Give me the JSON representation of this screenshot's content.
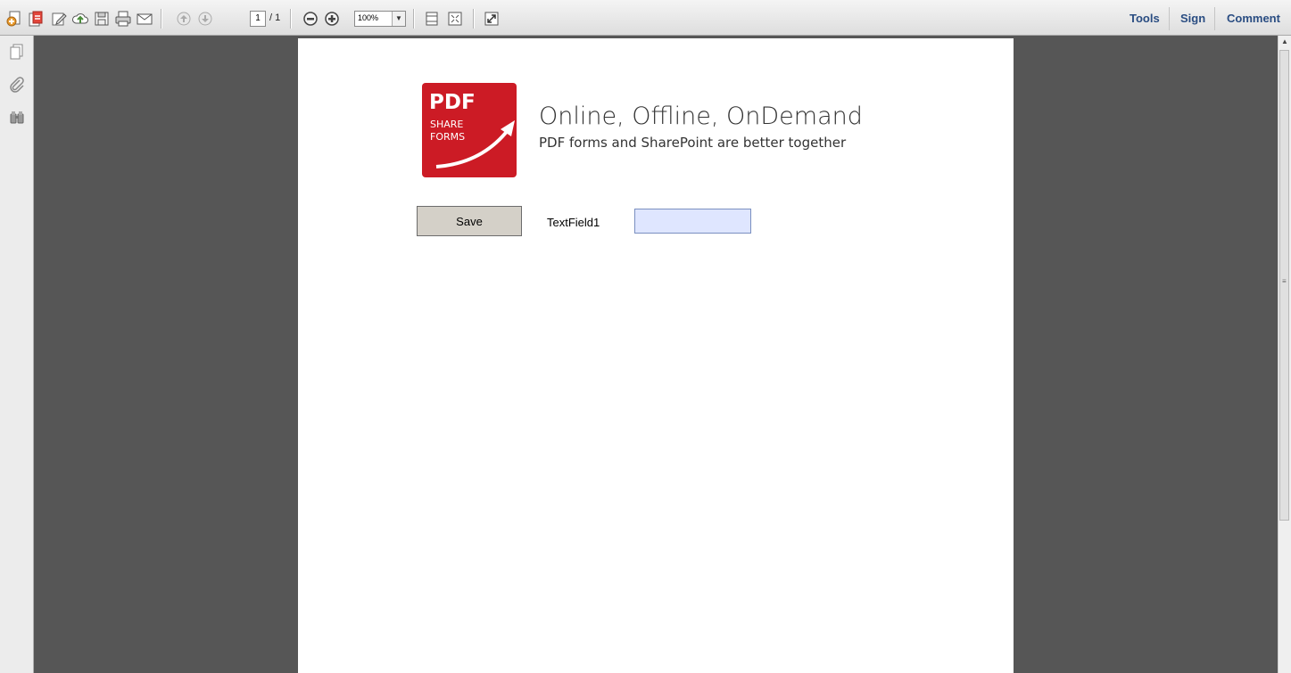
{
  "toolbar": {
    "page_current": "1",
    "page_total": "/ 1",
    "zoom": "100%",
    "tools_label": "Tools",
    "sign_label": "Sign",
    "comment_label": "Comment"
  },
  "icons": [
    "create-pdf-icon",
    "open-pdf-icon",
    "edit-icon",
    "upload-cloud-icon",
    "save-icon",
    "print-icon",
    "email-icon",
    "previous-page-icon",
    "next-page-icon",
    "zoom-out-icon",
    "zoom-in-icon",
    "fit-width-icon",
    "fit-page-icon",
    "full-screen-icon",
    "pages-panel-icon",
    "attachments-icon",
    "search-binoculars-icon"
  ],
  "document": {
    "logo": {
      "line1": "PDF",
      "line2": "SHARE",
      "line3": "FORMS"
    },
    "headline": "Online, Offline, OnDemand",
    "subline": "PDF forms and SharePoint are better together",
    "save_button": "Save",
    "field_label": "TextField1",
    "field_value": ""
  },
  "colors": {
    "brand_red": "#cc1b25",
    "viewer_bg": "#565656",
    "field_fill": "#dfe6ff",
    "link_blue": "#2a4d82"
  }
}
